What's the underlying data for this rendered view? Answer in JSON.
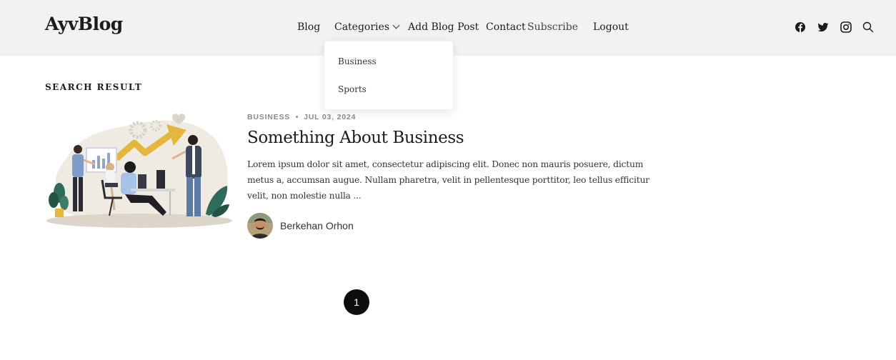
{
  "header": {
    "logo": "AyvBlog",
    "nav": {
      "blog": "Blog",
      "categories": "Categories",
      "add_post": "Add Blog Post",
      "contact": "Contact",
      "subscribe": "Subscribe",
      "logout": "Logout"
    },
    "social_icons": [
      "facebook-icon",
      "twitter-icon",
      "instagram-icon",
      "search-icon"
    ]
  },
  "dropdown": {
    "items": [
      "Business",
      "Sports"
    ]
  },
  "main": {
    "section_title": "SEARCH RESULT",
    "post": {
      "category": "BUSINESS",
      "date": "JUL 03, 2024",
      "title": "Something About Business",
      "excerpt": "Lorem ipsum dolor sit amet, consectetur adipiscing elit. Donec non mauris posuere, dictum metus a, accumsan augue. Nullam pharetra, velit in pellentesque porttitor, leo tellus efficitur velit, non molestie nulla ...",
      "author": "Berkehan Orhon"
    }
  },
  "pagination": {
    "current": "1"
  },
  "colors": {
    "header_bg": "#f2f2f2",
    "text": "#1c1c1c",
    "meta": "#8a8a8a",
    "page_active": "#0d0d0d"
  }
}
